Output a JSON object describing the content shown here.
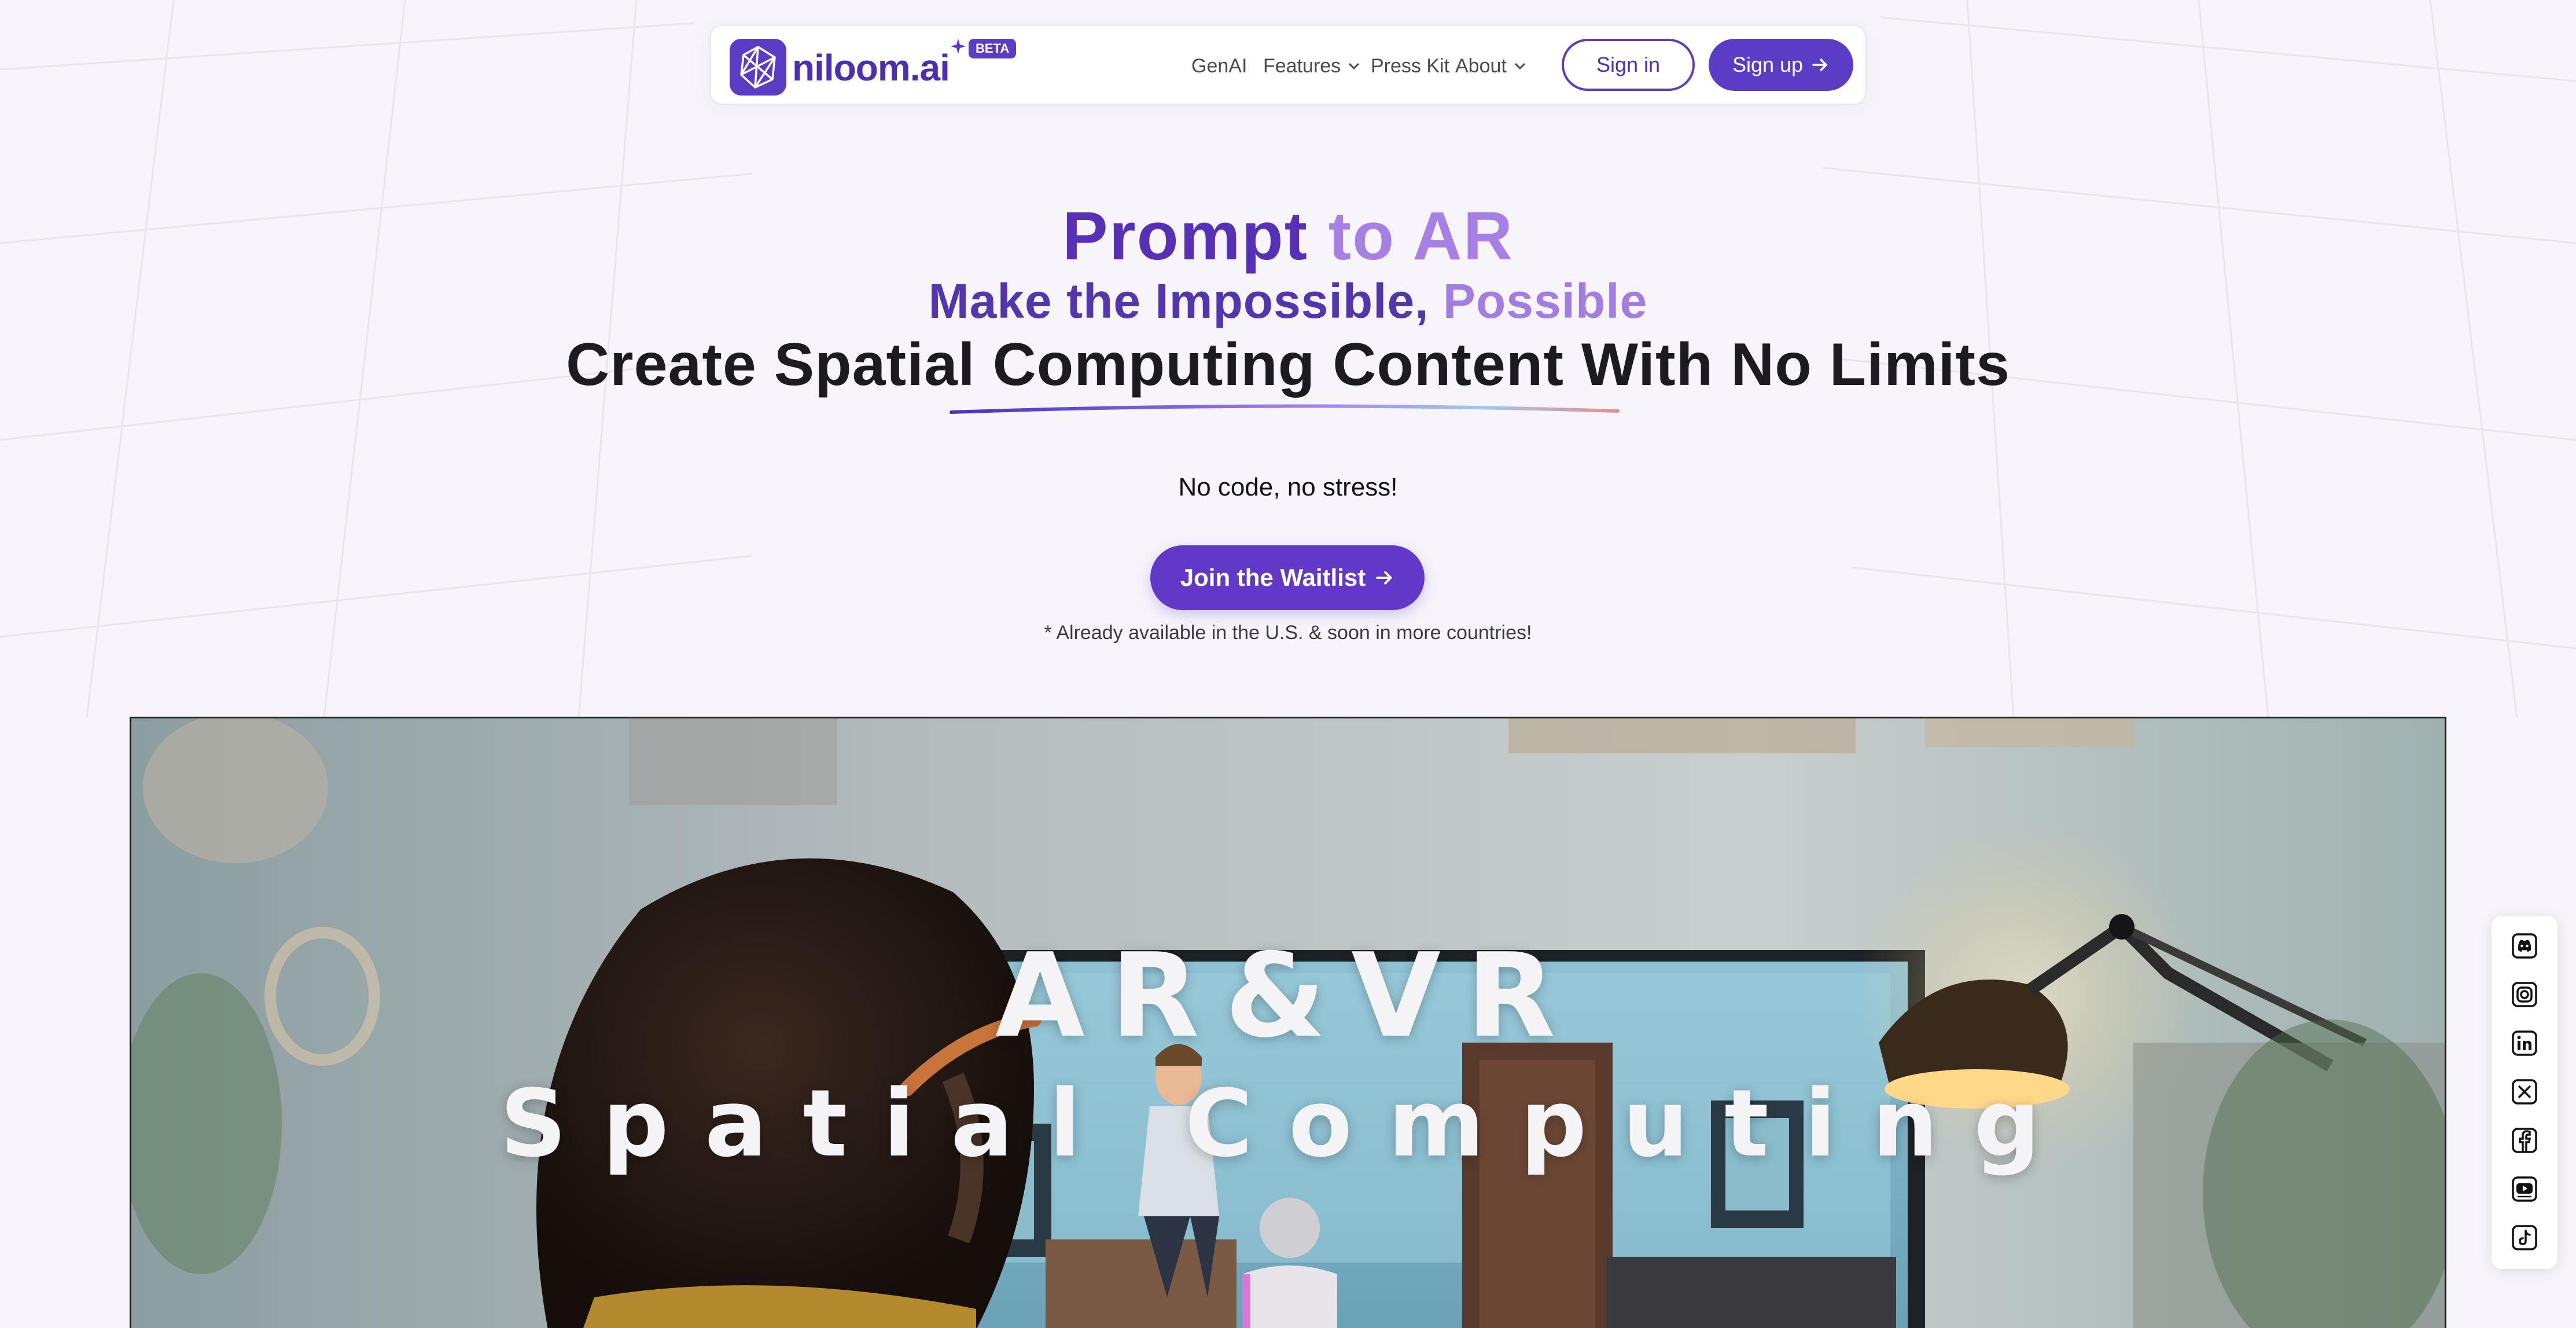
{
  "nav": {
    "logo_text": "niloom.ai",
    "beta_badge": "BETA",
    "links": [
      {
        "label": "GenAI"
      },
      {
        "label": "Features"
      },
      {
        "label": "Press Kit"
      },
      {
        "label": "About"
      }
    ],
    "sign_in": "Sign in",
    "sign_up": "Sign up"
  },
  "hero": {
    "line1_a": "Prompt",
    "line1_b": "to AR",
    "line2_a": "Make the Impossible,",
    "line2_b": "Possible",
    "line3": "Create Spatial Computing Content With No Limits",
    "tagline": "No code, no stress!",
    "cta": "Join the Waitlist",
    "note": "* Already available in the U.S. & soon in more countries!"
  },
  "video": {
    "title": "AR&VR",
    "subtitle": "Spatial Computing"
  },
  "social": {
    "icons": [
      "discord-icon",
      "instagram-icon",
      "linkedin-icon",
      "x-icon",
      "facebook-icon",
      "youtube-icon",
      "tiktok-icon"
    ]
  },
  "colors": {
    "brand": "#5b3cc4",
    "brand_light": "#a780e6",
    "background": "#f7f5fb"
  }
}
